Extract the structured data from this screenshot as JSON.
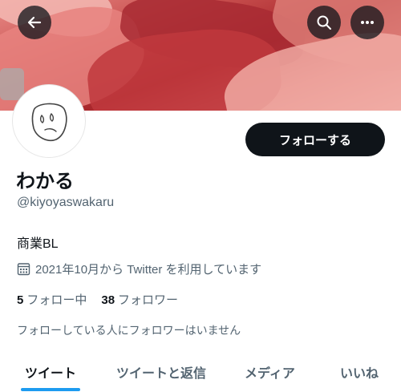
{
  "header": {
    "back_icon": "arrow-left-icon",
    "search_icon": "search-icon",
    "more_icon": "more-horizontal-icon"
  },
  "profile": {
    "display_name": "わかる",
    "handle": "@kiyoyaswakaru",
    "bio": "商業BL",
    "joined_icon": "calendar-icon",
    "joined_text": "2021年10月から Twitter を利用しています",
    "follow_button_label": "フォローする",
    "following_count": "5",
    "following_label": "フォロー中",
    "followers_count": "38",
    "followers_label": "フォロワー",
    "followers_you_know": "フォローしている人にフォロワーはいません"
  },
  "tabs": [
    {
      "label": "ツイート",
      "active": true
    },
    {
      "label": "ツイートと返信",
      "active": false
    },
    {
      "label": "メディア",
      "active": false
    },
    {
      "label": "いいね",
      "active": false
    }
  ],
  "colors": {
    "accent": "#1d9bf0",
    "text_primary": "#0f1419",
    "text_secondary": "#536471",
    "button_dark": "#0f1419"
  }
}
